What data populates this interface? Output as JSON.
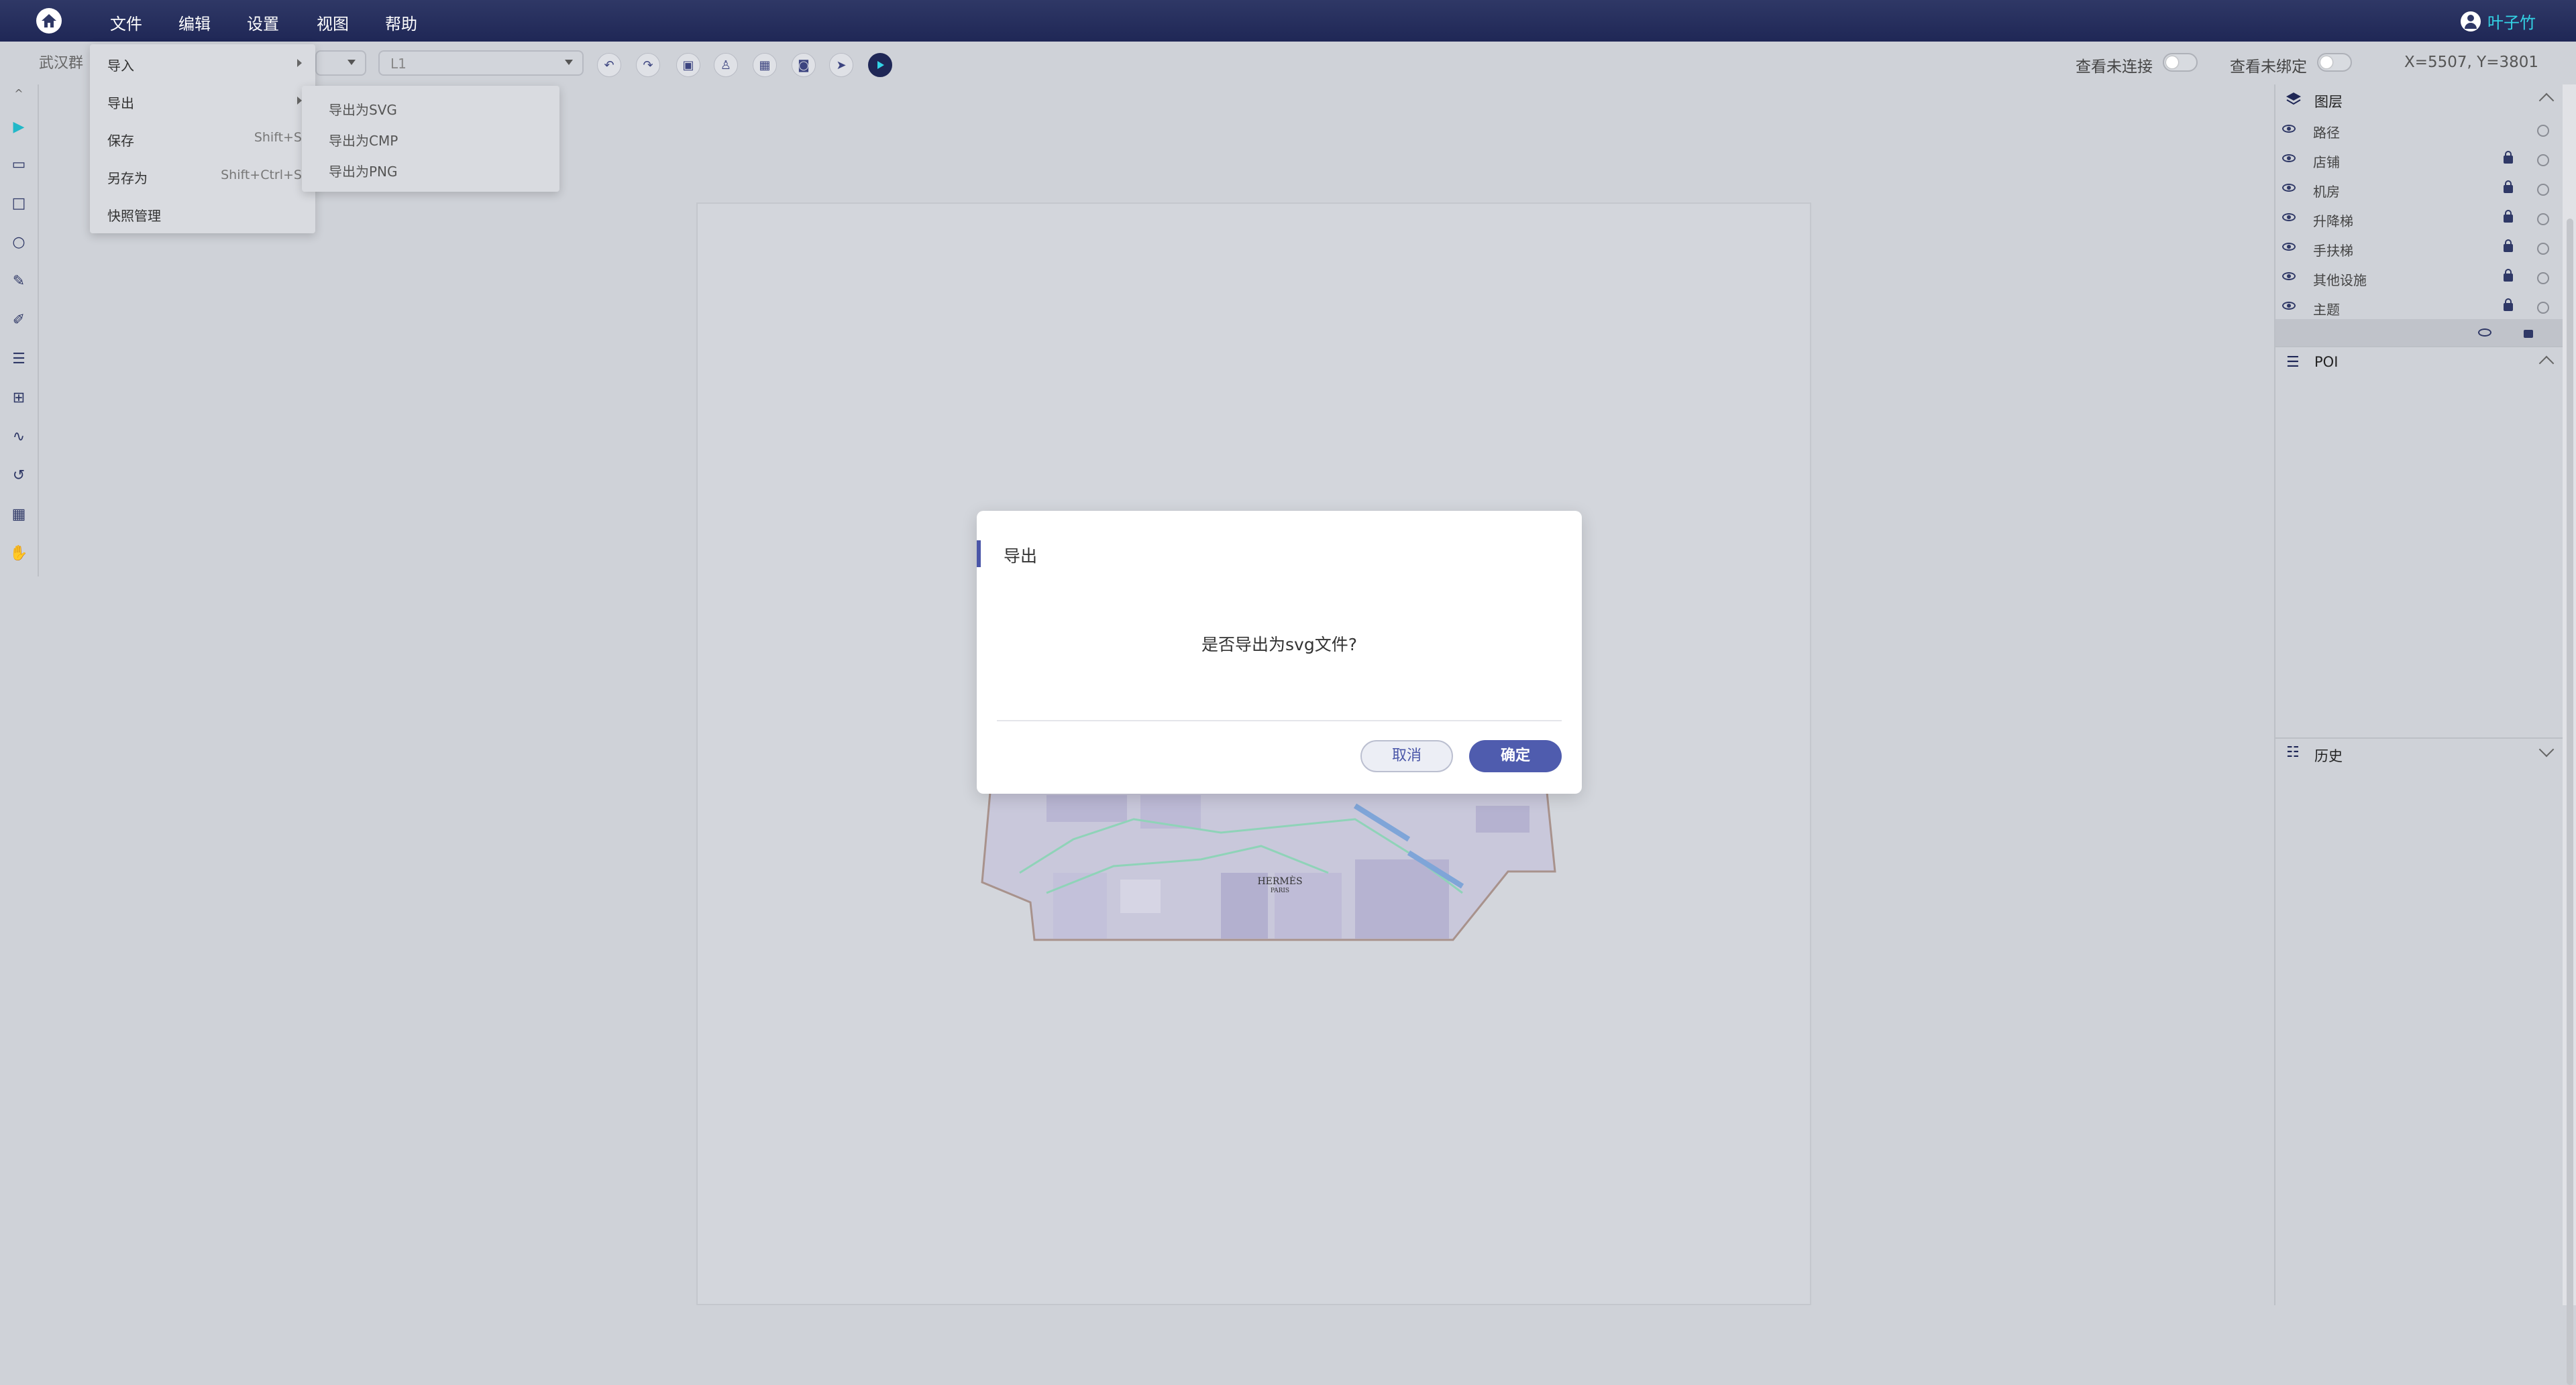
{
  "topbar": {
    "menus": [
      "文件",
      "编辑",
      "设置",
      "视图",
      "帮助"
    ],
    "user_name": "叶子竹"
  },
  "toolbar": {
    "project_name": "武汉群",
    "floor_value": "L1",
    "toggle_unconnected_label": "查看未连接",
    "toggle_unbound_label": "查看未绑定",
    "coords": "X=5507, Y=3801"
  },
  "file_menu": {
    "import": "导入",
    "export": "导出",
    "save": "保存",
    "save_shortcut": "Shift+S",
    "save_as": "另存为",
    "save_as_shortcut": "Shift+Ctrl+S",
    "snapshot": "快照管理"
  },
  "export_submenu": {
    "svg": "导出为SVG",
    "cmp": "导出为CMP",
    "png": "导出为PNG"
  },
  "right_panel": {
    "layers_title": "图层",
    "layers": [
      "路径",
      "店铺",
      "机房",
      "升降梯",
      "手扶梯",
      "其他设施",
      "主题"
    ],
    "poi_title": "POI",
    "history_title": "历史"
  },
  "dialog": {
    "title": "导出",
    "message": "是否导出为svg文件?",
    "cancel": "取消",
    "ok": "确定"
  },
  "map": {
    "logo_line1": "HERMÈS",
    "logo_line2": "PARIS"
  }
}
